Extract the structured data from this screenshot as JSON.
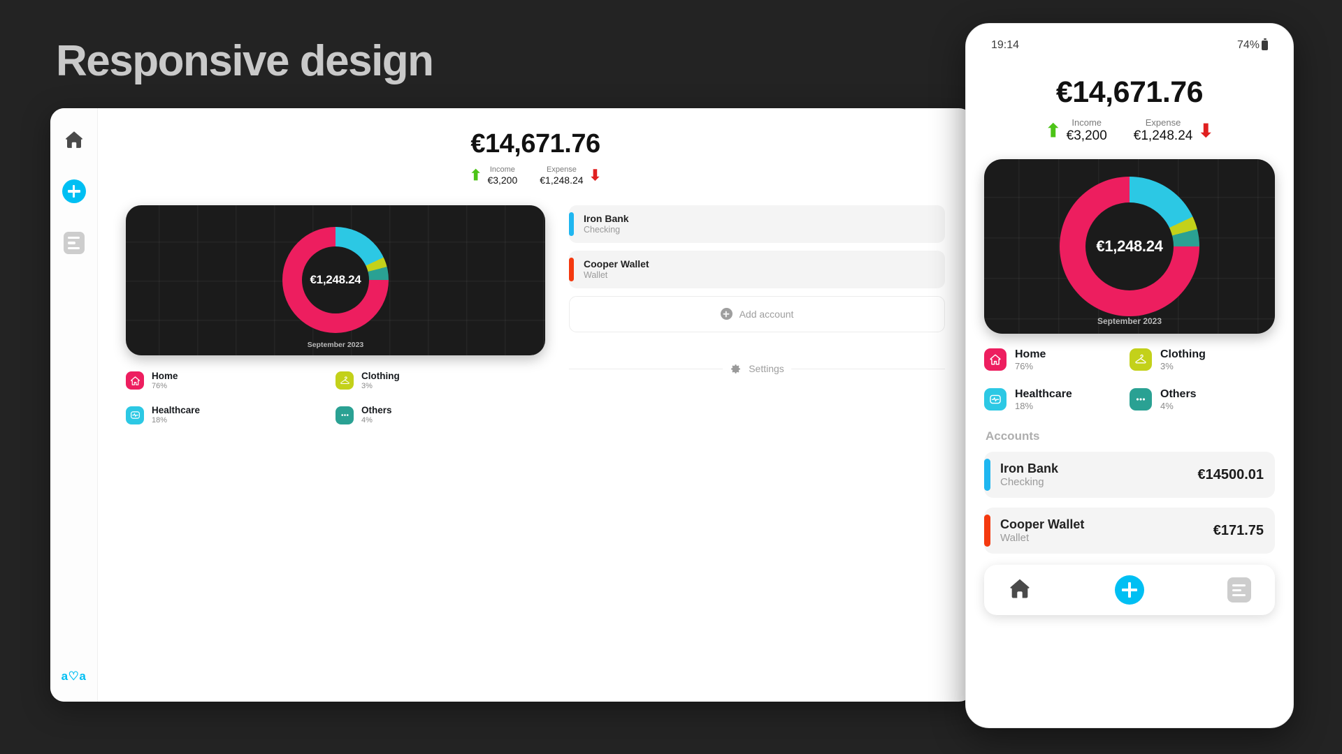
{
  "page": {
    "title": "Responsive design",
    "background_color": "#232323"
  },
  "desktop": {
    "sidebar": {
      "items": [
        {
          "icon": "home-icon",
          "label": "Home"
        },
        {
          "icon": "plus-icon",
          "label": "Add"
        },
        {
          "icon": "list-icon",
          "label": "Records"
        }
      ],
      "logo": "a♡a",
      "logo_color": "#00BFF3"
    },
    "balance": {
      "total": "€14,671.76",
      "income_label": "Income",
      "income_value": "€3,200",
      "income_arrow": "arrow-up-icon",
      "income_color": "#4CC417",
      "expense_label": "Expense",
      "expense_value": "€1,248.24",
      "expense_arrow": "arrow-down-icon",
      "expense_color": "#E02020"
    },
    "accounts": [
      {
        "name": "Iron Bank",
        "type": "Checking",
        "color": "#1FB6F0",
        "amount": ""
      },
      {
        "name": "Cooper Wallet",
        "type": "Wallet",
        "color": "#F4390F",
        "amount": ""
      }
    ],
    "add_account_label": "Add account",
    "settings_label": "Settings"
  },
  "phone": {
    "status_bar": {
      "time": "19:14",
      "battery_percent": "74%"
    },
    "balance": {
      "total": "€14,671.76",
      "income_label": "Income",
      "income_value": "€3,200",
      "expense_label": "Expense",
      "expense_value": "€1,248.24"
    },
    "accounts_heading": "Accounts",
    "accounts": [
      {
        "name": "Iron Bank",
        "type": "Checking",
        "color": "#1FB6F0",
        "amount": "€14500.01"
      },
      {
        "name": "Cooper Wallet",
        "type": "Wallet",
        "color": "#F4390F",
        "amount": "€171.75"
      }
    ],
    "nav": [
      {
        "icon": "home-icon",
        "label": "Home"
      },
      {
        "icon": "plus-icon",
        "label": "Add"
      },
      {
        "icon": "list-icon",
        "label": "Records"
      }
    ]
  },
  "chart_data": {
    "type": "pie",
    "title": "",
    "center_label": "€1,248.24",
    "footer_label": "September 2023",
    "categories": [
      "Home",
      "Healthcare",
      "Clothing",
      "Others"
    ],
    "values": [
      76,
      18,
      3,
      4
    ],
    "value_labels": [
      "76%",
      "18%",
      "3%",
      "4%"
    ],
    "colors": [
      "#ED1E5F",
      "#2CC8E4",
      "#C3D11A",
      "#2AA193"
    ],
    "icons": [
      "home-icon",
      "healthcare-icon",
      "clothing-hanger-icon",
      "others-dots-icon"
    ],
    "legend_position": "below",
    "grid": true,
    "donut": true,
    "start_angle_deg": 0,
    "direction": "clockwise",
    "segment_order": [
      "Healthcare",
      "Clothing",
      "Others",
      "Home"
    ]
  }
}
